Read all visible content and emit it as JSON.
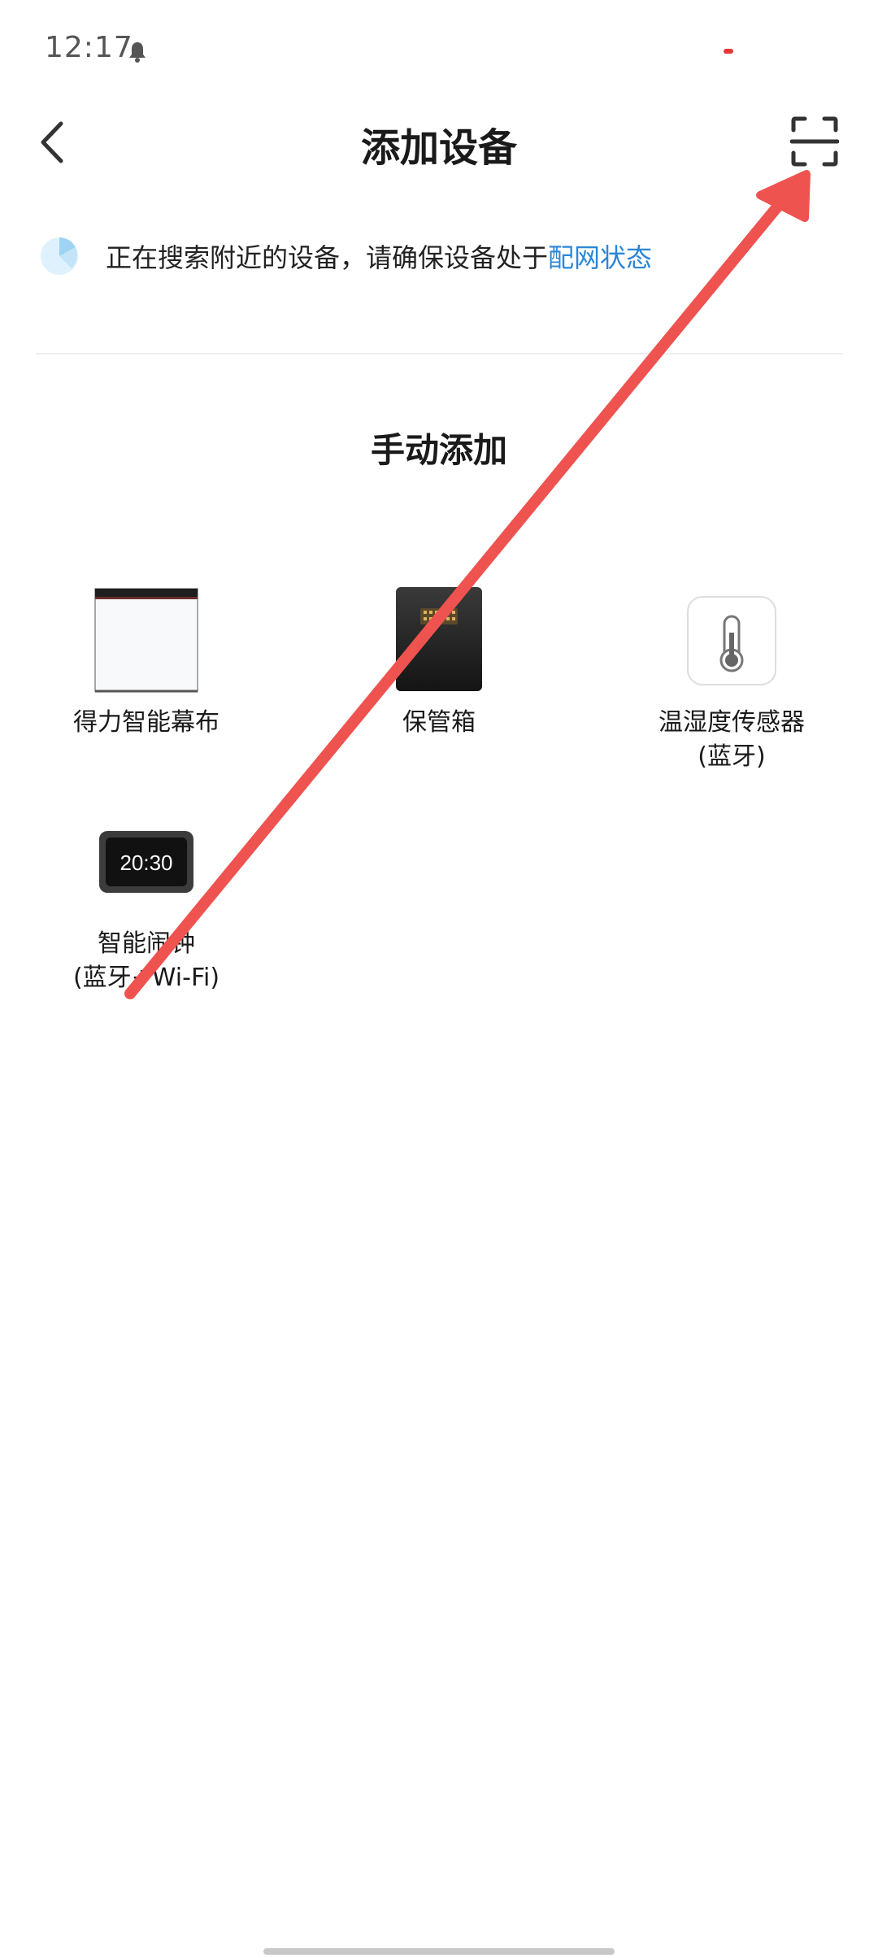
{
  "status_bar": {
    "time": "12:17",
    "icons": [
      "bell-icon"
    ],
    "indicator_color": "#e53935"
  },
  "app_bar": {
    "title": "添加设备",
    "back_icon": "chevron-left-icon",
    "scan_icon": "scan-icon"
  },
  "search": {
    "text": "正在搜索附近的设备，请确保设备处于",
    "link": "配网状态",
    "link_color": "#2b86d6"
  },
  "manual": {
    "title": "手动添加",
    "devices": [
      {
        "icon": "projector-screen-icon",
        "label": "得力智能幕布",
        "sub": ""
      },
      {
        "icon": "safe-box-icon",
        "label": "保管箱",
        "sub": ""
      },
      {
        "icon": "thermometer-icon",
        "label": "温湿度传感器",
        "sub": "(蓝牙)"
      },
      {
        "icon": "alarm-clock-icon",
        "label": "智能闹钟",
        "sub": "(蓝牙+Wi-Fi)",
        "display": "20:30"
      }
    ]
  },
  "annotation": {
    "type": "arrow",
    "color": "#ef5350"
  }
}
